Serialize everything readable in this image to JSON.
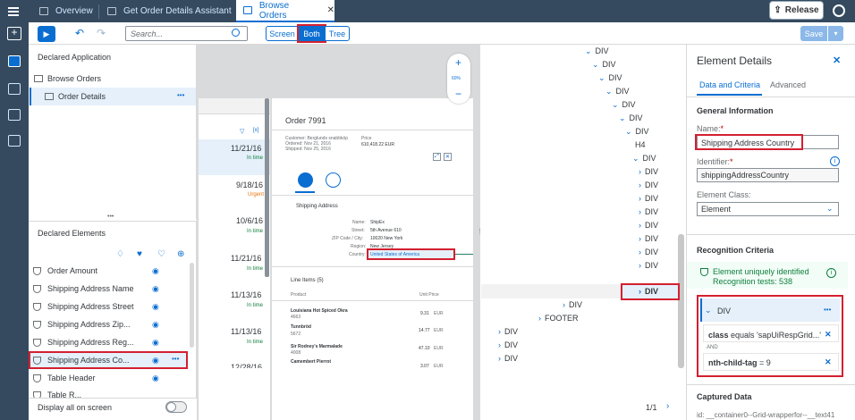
{
  "topbar": {
    "tabs": [
      "Overview",
      "Get Order Details Assistant",
      "Browse Orders"
    ],
    "release_label": "Release"
  },
  "toolbar": {
    "search_placeholder": "Search...",
    "views": [
      "Screen",
      "Both",
      "Tree"
    ],
    "save_label": "Save"
  },
  "declared_app": {
    "title": "Declared Application",
    "items": [
      "Browse Orders",
      "Order Details"
    ],
    "more": "•••"
  },
  "declared_elements": {
    "title": "Declared Elements",
    "items": [
      "Order Amount",
      "Shipping Address Name",
      "Shipping Address Street",
      "Shipping Address Zip...",
      "Shipping Address Reg...",
      "Shipping Address Co...",
      "Table Header",
      "Table R..."
    ],
    "display_all": "Display all on screen"
  },
  "screen": {
    "zoom_plus": "+",
    "zoom_level": "60%",
    "zoom_minus": "−",
    "left_list": [
      {
        "date": "11/21/16",
        "status": "In time"
      },
      {
        "date": "9/18/16",
        "status": "Urgent"
      },
      {
        "date": "10/6/16",
        "status": "In time"
      },
      {
        "date": "11/21/16",
        "status": "In time"
      },
      {
        "date": "11/13/16",
        "status": "In time"
      },
      {
        "date": "11/13/16",
        "status": "In time"
      },
      {
        "date": "12/28/16",
        "status": ""
      }
    ],
    "order_title": "Order 7991",
    "customer": "Customer: Berglunds snabbköp",
    "ordered": "Ordered: Nov 21, 2016",
    "shipped": "Shipped: Nov 25, 2016",
    "price_label": "Price",
    "price_value": "610,418.22 EUR",
    "shipping_title": "Shipping Address",
    "addr_labels": [
      "Name:",
      "Street:",
      "ZIP Code / City:",
      "Region:",
      "Country:"
    ],
    "addr_values": [
      "ShipEx",
      "5th Avenue 610",
      "10020 New York",
      "New Jersey",
      "United States of America"
    ],
    "line_items_title": "Line Items (5)",
    "col_product": "Product",
    "col_price": "Unit Price",
    "items": [
      {
        "name": "Louisiana Hot Spiced Okra",
        "id": "4663",
        "price": "9.31",
        "cur": "EUR"
      },
      {
        "name": "Tunnbröd",
        "id": "5672",
        "price": "14.77",
        "cur": "EUR"
      },
      {
        "name": "Sir Rodney's Marmalade",
        "id": "4008",
        "price": "47.10",
        "cur": "EUR"
      },
      {
        "name": "Camembert Pierrot",
        "id": "",
        "price": "3.07",
        "cur": "EUR"
      }
    ]
  },
  "tree": {
    "rows": [
      "DIV",
      "DIV",
      "DIV",
      "DIV",
      "DIV",
      "DIV",
      "DIV",
      "H4",
      "DIV",
      "DIV",
      "DIV",
      "DIV",
      "DIV",
      "DIV",
      "DIV",
      "DIV",
      "DIV",
      "DIV",
      "FOOTER",
      "DIV",
      "DIV",
      "DIV"
    ],
    "pager": "1/1"
  },
  "details": {
    "title": "Element Details",
    "tabs": [
      "Data and Criteria",
      "Advanced"
    ],
    "general_title": "General Information",
    "name_label": "Name:",
    "name_value": "Shipping Address Country",
    "identifier_label": "Identifier:",
    "identifier_value": "shippingAddressCountry",
    "class_label": "Element Class:",
    "class_value": "Element",
    "recog_title": "Recognition Criteria",
    "recog_status": "Element uniquely identified",
    "recog_tests": "Recognition tests: 538",
    "criteria_node": "DIV",
    "criteria_more": "•••",
    "crit1_key": "class",
    "crit1_rest": " equals 'sapUiRespGrid...'",
    "and_label": "AND",
    "crit2_key": "nth-child-tag",
    "crit2_rest": " = 9",
    "captured_title": "Captured Data",
    "captured_id": "id: __container0--Grid-wrapperfor--__text41"
  },
  "colors": {
    "shell": "#354a5f",
    "accent": "#0a6ed1",
    "highlight": "#d32030",
    "success": "#107e3e"
  }
}
